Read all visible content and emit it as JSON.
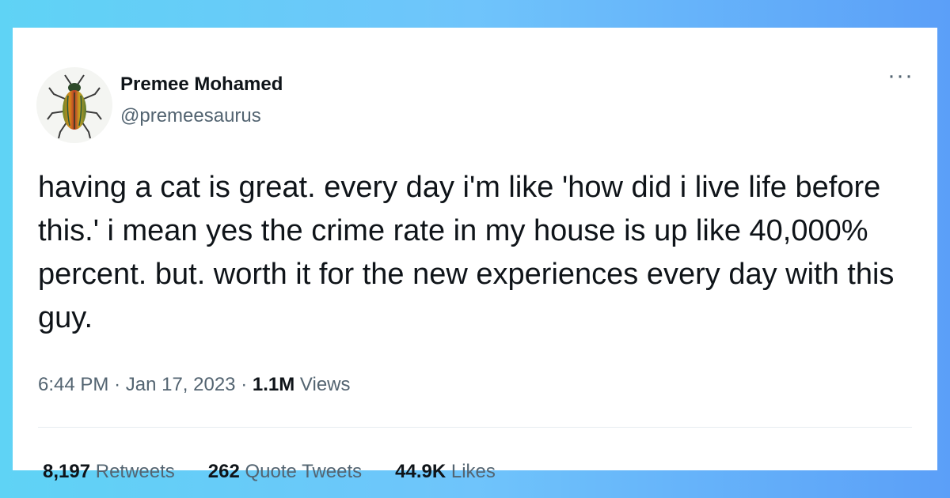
{
  "tweet": {
    "author": {
      "name": "Premee Mohamed",
      "handle": "@premeesaurus",
      "avatar_icon": "beetle-icon"
    },
    "text": "having a cat is great. every day i'm like 'how did i live life before this.' i mean yes the crime rate in my house is up like 40,000% percent. but. worth it for the new experiences every day with this guy.",
    "time": "6:44 PM",
    "date": "Jan 17, 2023",
    "separator": "·",
    "views_count": "1.1M",
    "views_label": "Views",
    "more_icon": "···"
  },
  "stats": {
    "retweets_count": "8,197",
    "retweets_label": "Retweets",
    "quotes_count": "262",
    "quotes_label": "Quote Tweets",
    "likes_count": "44.9K",
    "likes_label": "Likes"
  },
  "colors": {
    "background_start": "#5fd3f5",
    "background_end": "#5b9ff8",
    "card": "#ffffff",
    "text_primary": "#0f1419",
    "text_secondary": "#536471"
  }
}
